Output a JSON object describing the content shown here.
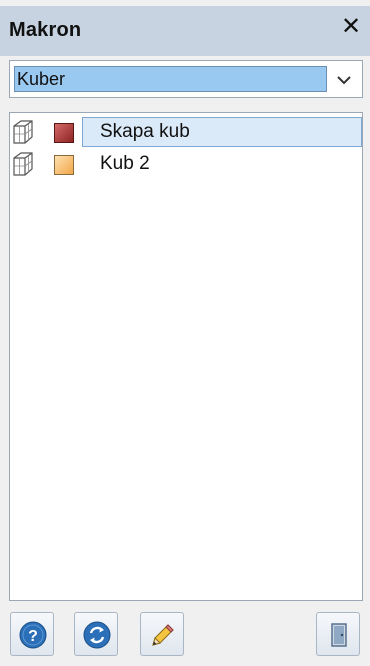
{
  "window": {
    "title": "Makron",
    "close_glyph": "✕"
  },
  "dropdown": {
    "selected": "Kuber",
    "icon": "chevron-down-icon"
  },
  "macros": [
    {
      "label": "Skapa kub",
      "icon": "cube-icon",
      "color": "#b23a3a",
      "selected": true
    },
    {
      "label": "Kub 2",
      "icon": "cube-icon",
      "color": "#f3b567",
      "selected": false
    }
  ],
  "footer": {
    "buttons": [
      {
        "name": "help-button",
        "icon": "help-icon"
      },
      {
        "name": "refresh-button",
        "icon": "refresh-icon"
      },
      {
        "name": "edit-button",
        "icon": "pencil-icon"
      },
      {
        "name": "exit-button",
        "icon": "exit-door-icon"
      }
    ]
  }
}
